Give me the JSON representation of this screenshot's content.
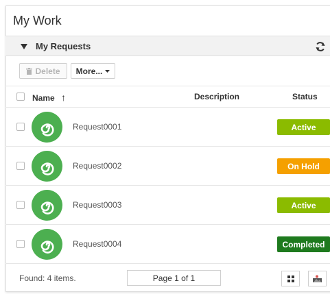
{
  "page": {
    "title": "My Work"
  },
  "section": {
    "title": "My Requests"
  },
  "toolbar": {
    "delete_label": "Delete",
    "more_label": "More..."
  },
  "table": {
    "headers": {
      "name": "Name",
      "description": "Description",
      "status": "Status"
    },
    "sort_indicator": "↑",
    "rows": [
      {
        "name": "Request0001",
        "description": "",
        "status": "Active",
        "status_color": "#8bbb00"
      },
      {
        "name": "Request0002",
        "description": "",
        "status": "On Hold",
        "status_color": "#f5a000"
      },
      {
        "name": "Request0003",
        "description": "",
        "status": "Active",
        "status_color": "#8bbb00"
      },
      {
        "name": "Request0004",
        "description": "",
        "status": "Completed",
        "status_color": "#1e7a1e"
      }
    ]
  },
  "footer": {
    "found_text": "Found: 4 items.",
    "pager_text": "Page 1 of 1"
  },
  "icons": {
    "collapse": "triangle-down-icon",
    "refresh": "refresh-icon",
    "trash": "trash-icon",
    "dropdown": "chevron-down-icon",
    "avatar": "spiral-icon",
    "grid_view": "grid-icon",
    "image_view": "image-icon"
  },
  "colors": {
    "avatar_green": "#4caf50"
  }
}
